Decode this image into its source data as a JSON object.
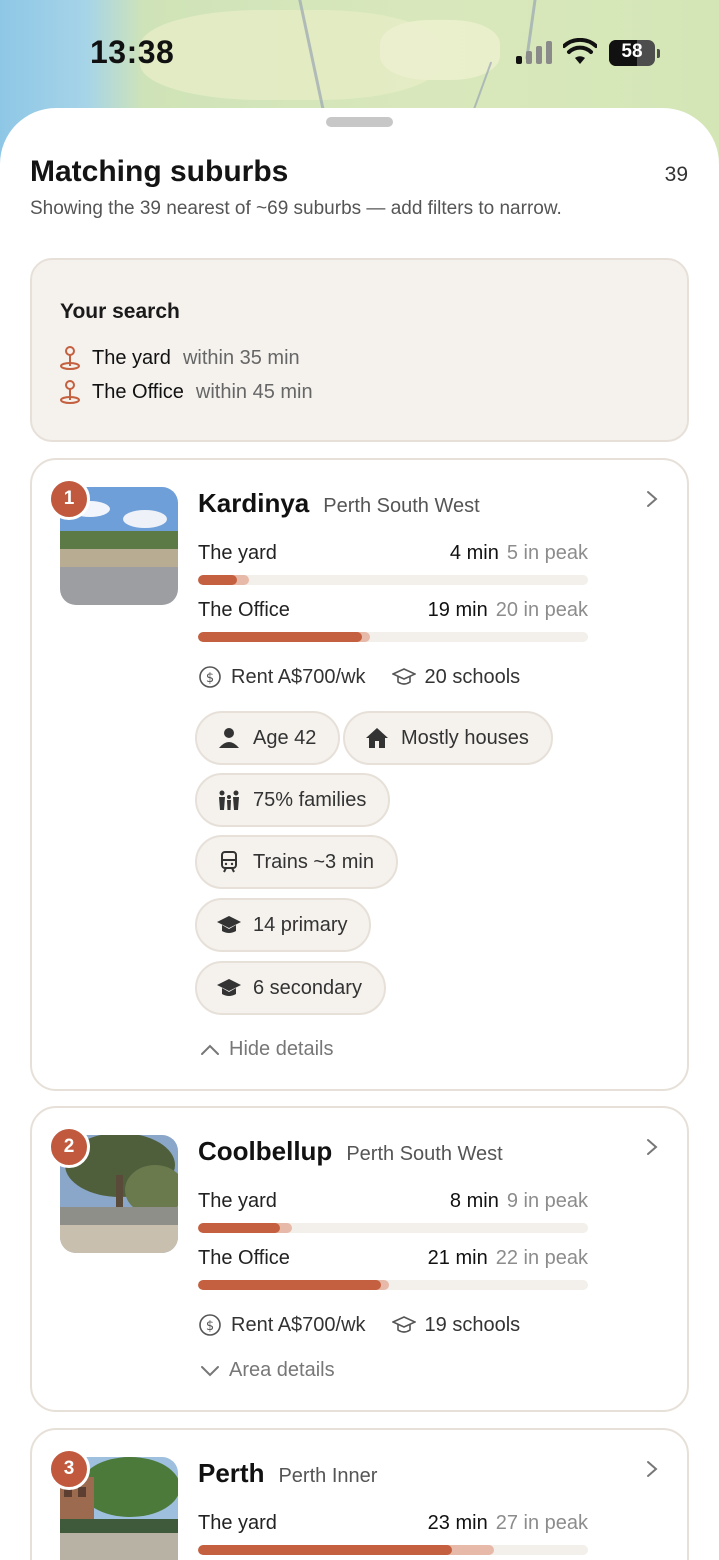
{
  "status_bar": {
    "time": "13:38",
    "battery": "58"
  },
  "sheet": {
    "title": "Matching suburbs",
    "count": "39",
    "subtitle": "Showing the 39 nearest of ~69 suburbs — add filters to narrow."
  },
  "search": {
    "heading": "Your search",
    "places": [
      {
        "name": "The yard",
        "within": "within 35 min"
      },
      {
        "name": "The Office",
        "within": "within 45 min"
      }
    ]
  },
  "results": [
    {
      "rank": "1",
      "name": "Kardinya",
      "region": "Perth South West",
      "commutes": [
        {
          "label": "The yard",
          "mins": "4 min",
          "peak": "5 in peak",
          "fill": 0.1,
          "peak_fill": 0.13
        },
        {
          "label": "The Office",
          "mins": "19 min",
          "peak": "20 in peak",
          "fill": 0.42,
          "peak_fill": 0.44
        }
      ],
      "rent": "Rent A$700/wk",
      "schools": "20 schools",
      "chips": [
        "Age 42",
        "Mostly houses",
        "75% families",
        "Trains ~3 min",
        "14 primary",
        "6 secondary"
      ],
      "toggle": "Hide details"
    },
    {
      "rank": "2",
      "name": "Coolbellup",
      "region": "Perth South West",
      "commutes": [
        {
          "label": "The yard",
          "mins": "8 min",
          "peak": "9 in peak",
          "fill": 0.21,
          "peak_fill": 0.24
        },
        {
          "label": "The Office",
          "mins": "21 min",
          "peak": "22 in peak",
          "fill": 0.47,
          "peak_fill": 0.49
        }
      ],
      "rent": "Rent A$700/wk",
      "schools": "19 schools",
      "toggle": "Area details"
    },
    {
      "rank": "3",
      "name": "Perth",
      "region": "Perth Inner",
      "commutes": [
        {
          "label": "The yard",
          "mins": "23 min",
          "peak": "27 in peak",
          "fill": 0.65,
          "peak_fill": 0.76
        }
      ]
    }
  ],
  "colors": {
    "accent": "#c4603f",
    "peak": "#e6b9a9",
    "chip_bg": "#f5f2ee"
  }
}
